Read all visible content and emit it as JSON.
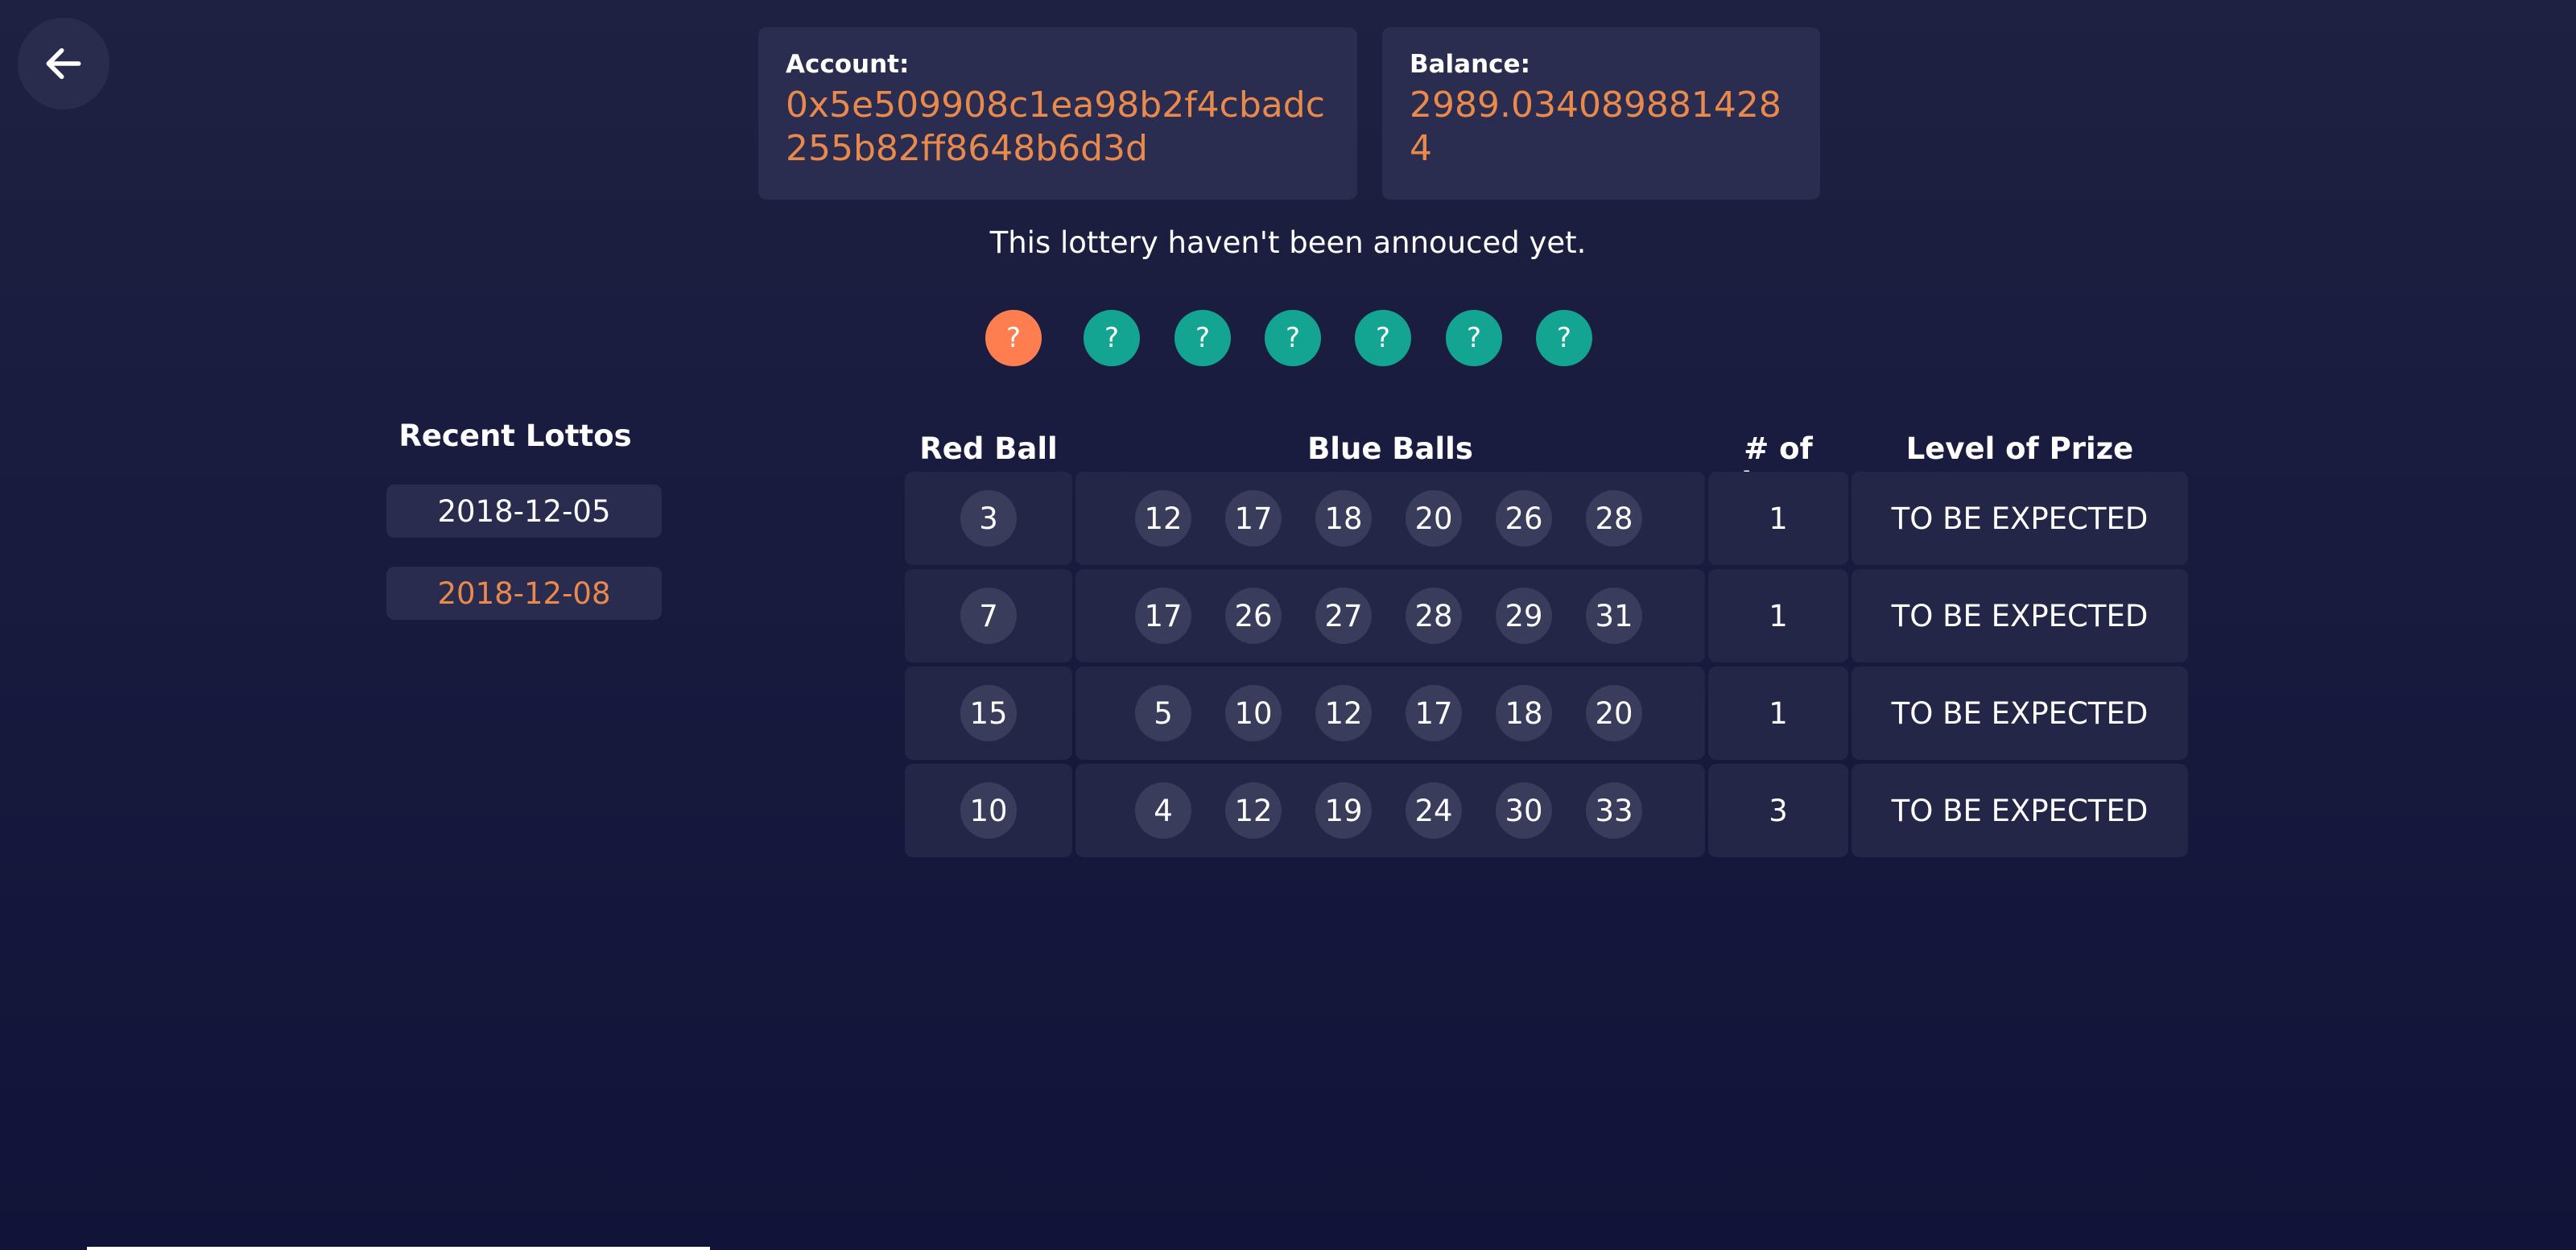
{
  "account": {
    "label": "Account:",
    "value_line1": "0x5e509908c1ea98b2f4cbadc",
    "value_line2": "255b82ff8648b6d3d"
  },
  "balance": {
    "label": "Balance:",
    "value": "2989.0340898814284"
  },
  "status_message": "This lottery haven't been annouced yet.",
  "result_balls": {
    "red": [
      "?"
    ],
    "blue": [
      "?",
      "?",
      "?",
      "?",
      "?",
      "?"
    ]
  },
  "recent": {
    "title": "Recent Lottos",
    "dates": [
      "2018-12-05",
      "2018-12-08"
    ]
  },
  "table": {
    "headers": {
      "red": "Red Ball",
      "blue": "Blue Balls",
      "bets": "# of bets",
      "prize": "Level of Prize"
    },
    "rows": [
      {
        "red": "3",
        "blue": [
          "12",
          "17",
          "18",
          "20",
          "26",
          "28"
        ],
        "bets": "1",
        "prize": "TO BE EXPECTED"
      },
      {
        "red": "7",
        "blue": [
          "17",
          "26",
          "27",
          "28",
          "29",
          "31"
        ],
        "bets": "1",
        "prize": "TO BE EXPECTED"
      },
      {
        "red": "15",
        "blue": [
          "5",
          "10",
          "12",
          "17",
          "18",
          "20"
        ],
        "bets": "1",
        "prize": "TO BE EXPECTED"
      },
      {
        "red": "10",
        "blue": [
          "4",
          "12",
          "19",
          "24",
          "30",
          "33"
        ],
        "bets": "3",
        "prize": "TO BE EXPECTED"
      }
    ]
  },
  "colors": {
    "accent_orange": "#e98a4c",
    "red_ball": "#ff7e4f",
    "blue_ball": "#13a592"
  },
  "icons": {
    "back": "arrow-left-icon"
  }
}
